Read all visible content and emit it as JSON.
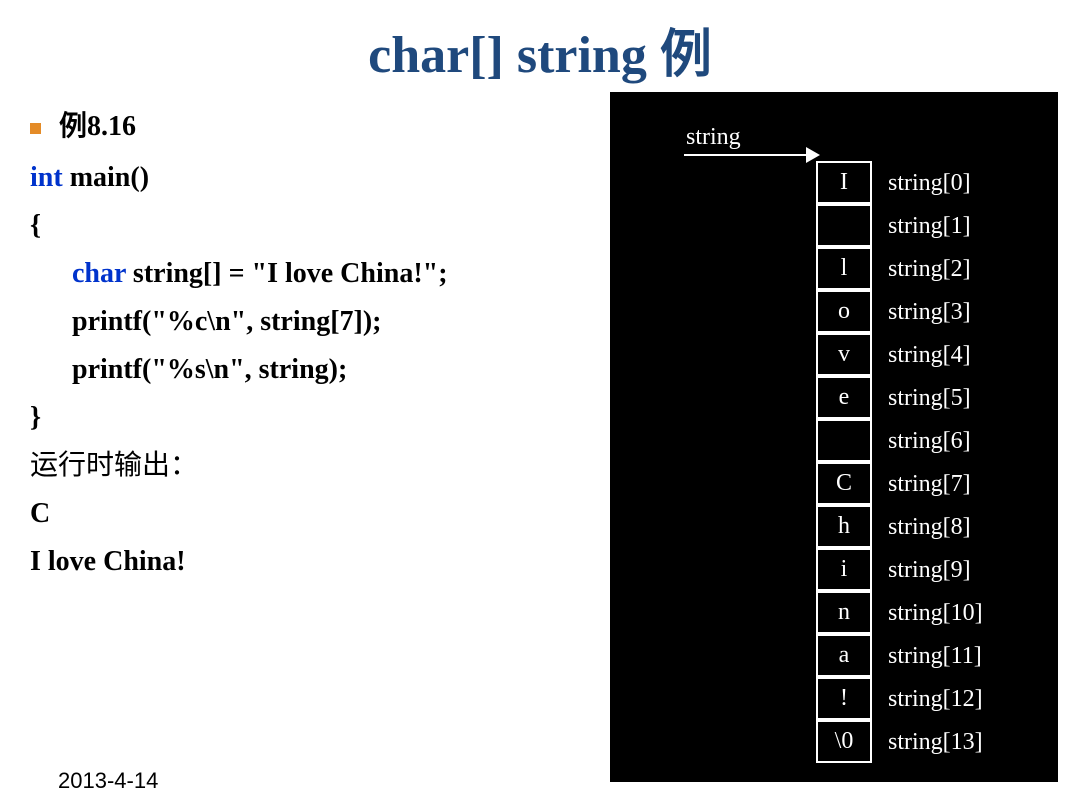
{
  "title": {
    "prefix": "char[] string ",
    "suffix_cn": "例"
  },
  "bullet_label": "例8.16",
  "code": {
    "l1_kw": "int",
    "l1_rest": " main()",
    "l2": "{",
    "l3_kw": "char",
    "l3_rest": " string[] = \"I love China!\";",
    "l4": "printf(\"%c\\n\", string[7]);",
    "l5": "printf(\"%s\\n\", string);",
    "l6": "}"
  },
  "run_label": "运行时输出：",
  "out1": "C",
  "out2": "I love China!",
  "footer_date": "2013-4-14",
  "diagram": {
    "pointer_label": "string",
    "rows": [
      {
        "char": "I",
        "label": "string[0]"
      },
      {
        "char": "",
        "label": "string[1]"
      },
      {
        "char": "l",
        "label": "string[2]"
      },
      {
        "char": "o",
        "label": "string[3]"
      },
      {
        "char": "v",
        "label": "string[4]"
      },
      {
        "char": "e",
        "label": "string[5]"
      },
      {
        "char": "",
        "label": "string[6]"
      },
      {
        "char": "C",
        "label": "string[7]"
      },
      {
        "char": "h",
        "label": "string[8]"
      },
      {
        "char": "i",
        "label": "string[9]"
      },
      {
        "char": "n",
        "label": "string[10]"
      },
      {
        "char": "a",
        "label": "string[11]"
      },
      {
        "char": "!",
        "label": "string[12]"
      },
      {
        "char": "\\0",
        "label": "string[13]"
      }
    ]
  }
}
